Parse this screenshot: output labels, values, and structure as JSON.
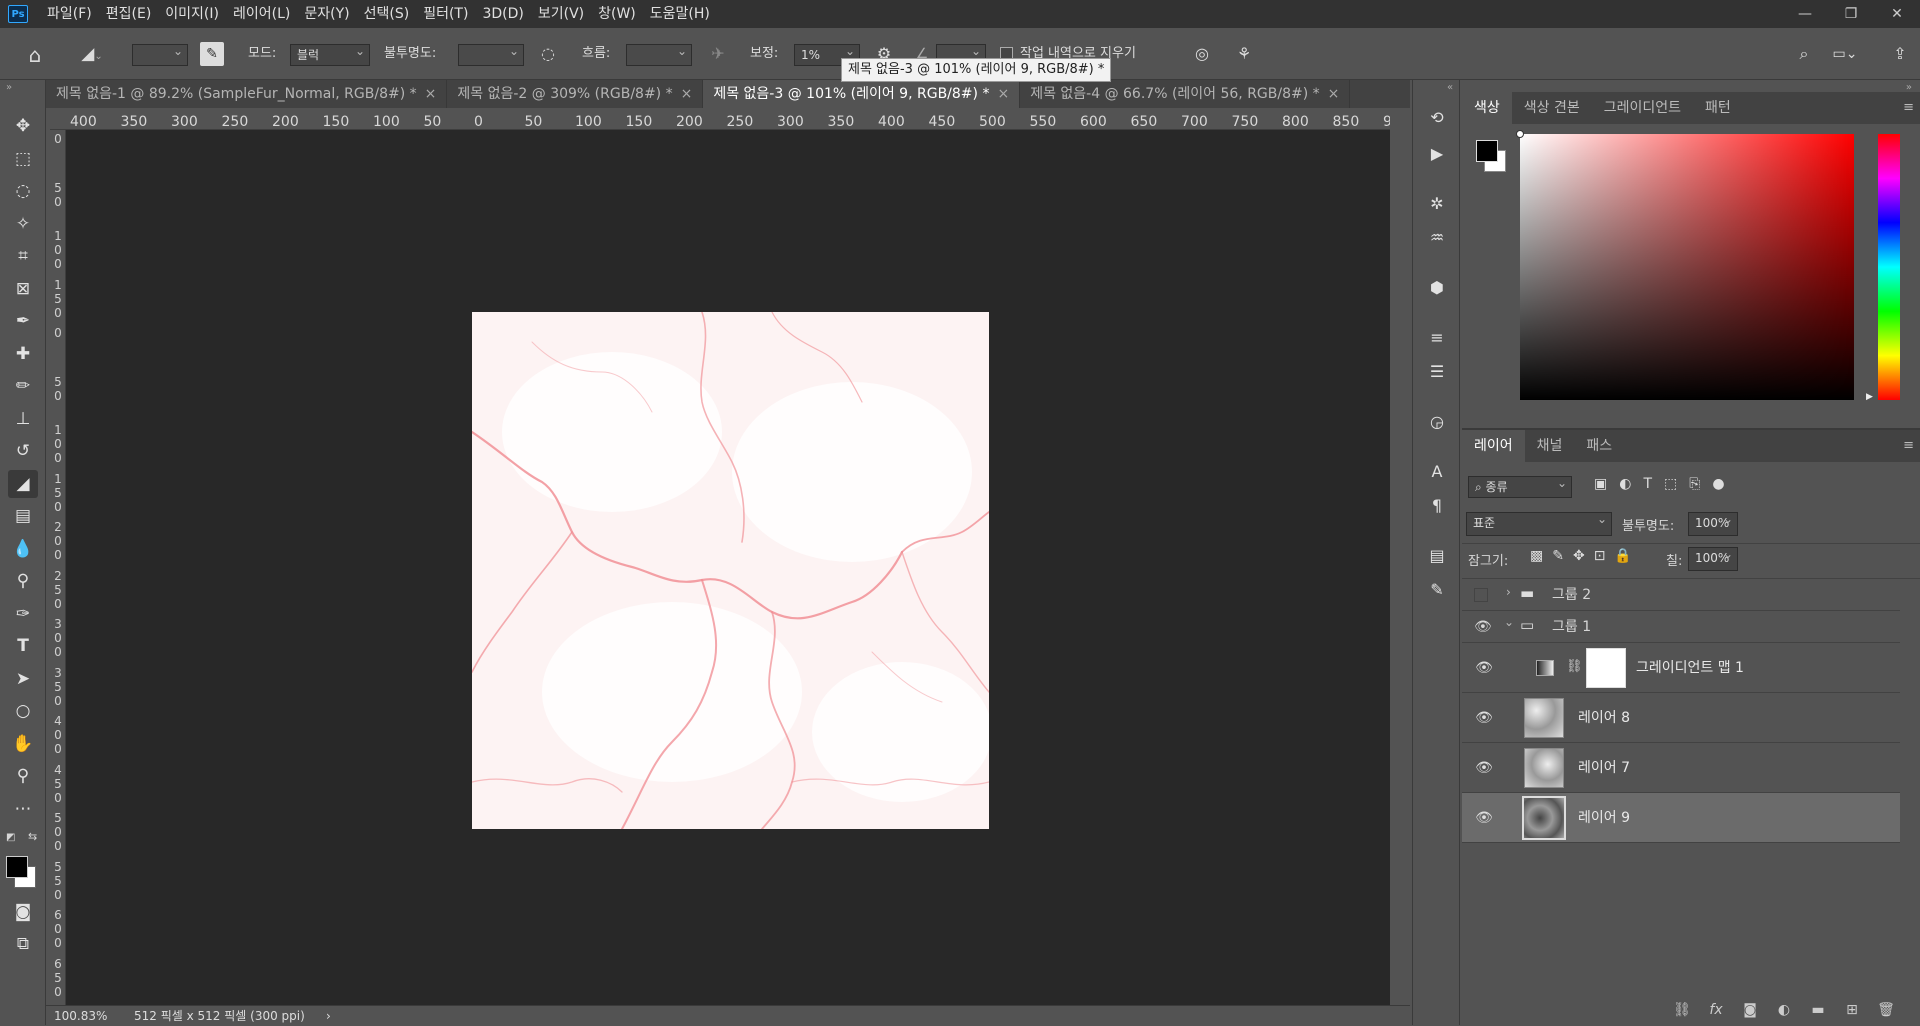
{
  "menu": {
    "logo": "Ps",
    "items": [
      "파일(F)",
      "편집(E)",
      "이미지(I)",
      "레이어(L)",
      "문자(Y)",
      "선택(S)",
      "필터(T)",
      "3D(D)",
      "보기(V)",
      "창(W)",
      "도움말(H)"
    ]
  },
  "window_controls": {
    "minimize": "—",
    "restore": "❐",
    "close": "✕"
  },
  "options": {
    "mode_label": "모드:",
    "mode_value": "블럭",
    "opacity_label": "불투명도:",
    "flow_label": "흐름:",
    "smoothing_label": "보정:",
    "smoothing_value": "1%",
    "erase_history_label": "작업 내역으로 지우기"
  },
  "tooltip": "제목 없음-3 @ 101% (레이어 9, RGB/8#) *",
  "tabs": [
    {
      "label": "제목 없음-1 @ 89.2% (SampleFur_Normal, RGB/8#) *"
    },
    {
      "label": "제목 없음-2 @ 309% (RGB/8#) *"
    },
    {
      "label": "제목 없음-3 @ 101% (레이어 9, RGB/8#) *"
    },
    {
      "label": "제목 없음-4 @ 66.7% (레이어 56, RGB/8#) *"
    }
  ],
  "tab_close": "×",
  "ruler_top": [
    "400",
    "350",
    "300",
    "250",
    "200",
    "150",
    "100",
    "50",
    "0",
    "50",
    "100",
    "150",
    "200",
    "250",
    "300",
    "350",
    "400",
    "450",
    "500",
    "550",
    "600",
    "650",
    "700",
    "750",
    "800",
    "850",
    "9"
  ],
  "ruler_left": [
    "0",
    "50",
    "100",
    "150",
    "0",
    "50",
    "100",
    "150",
    "200",
    "250",
    "300",
    "350",
    "400",
    "450",
    "500",
    "550",
    "600",
    "650"
  ],
  "status": {
    "zoom": "100.83%",
    "doc_size": "512 픽셀 x 512 픽셀 (300 ppi)",
    "arrow": "›"
  },
  "color_panel": {
    "tabs": [
      "색상",
      "색상 견본",
      "그레이디언트",
      "패턴"
    ]
  },
  "layers_panel": {
    "tabs": [
      "레이어",
      "채널",
      "패스"
    ],
    "filter_label": "종류",
    "blend_mode": "표준",
    "opacity_label": "불투명도:",
    "opacity_value": "100%",
    "lock_label": "잠그기:",
    "fill_label": "칠:",
    "fill_value": "100%",
    "layers": [
      {
        "name": "그룹 2"
      },
      {
        "name": "그룹 1"
      },
      {
        "name": "그레이디언트 맵 1"
      },
      {
        "name": "레이어 8"
      },
      {
        "name": "레이어 7"
      },
      {
        "name": "레이어 9"
      }
    ],
    "footer_fx": "fx"
  },
  "colors": {
    "accent": "#31a8ff",
    "canvas_bg": "#282828",
    "panel_bg": "#535353"
  }
}
